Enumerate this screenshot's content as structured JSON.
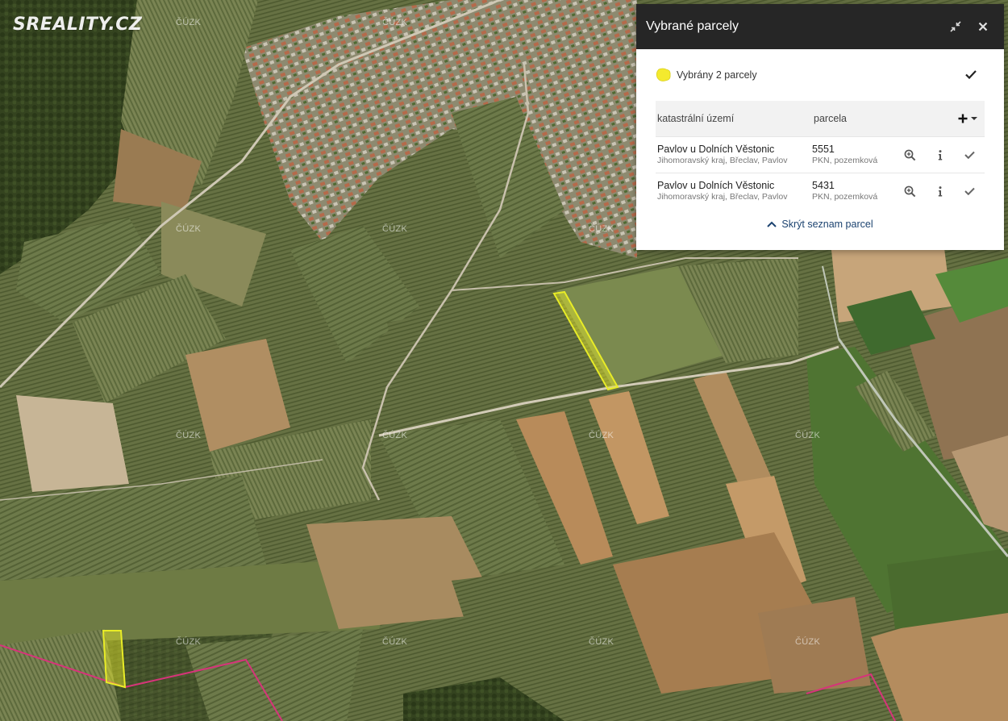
{
  "branding": {
    "logo_text": "SREALITY.CZ"
  },
  "map": {
    "watermark_text": "ČÚZK",
    "highlight_color": "#e8ec27",
    "boundary_color": "#d6347a"
  },
  "panel": {
    "title": "Vybrané parcely",
    "minimize_icon": "collapse-arrows-icon",
    "close_icon": "close-icon",
    "summary": {
      "text": "Vybrány 2 parcely",
      "shape_color": "#f4ea2e"
    },
    "table": {
      "headers": {
        "cadastral_area": "katastrální území",
        "parcel": "parcela"
      },
      "rows": [
        {
          "area_name": "Pavlov u Dolních Věstonic",
          "area_detail": "Jihomoravský kraj, Břeclav, Pavlov",
          "parcel_number": "5551",
          "parcel_type": "PKN, pozemková"
        },
        {
          "area_name": "Pavlov u Dolních Věstonic",
          "area_detail": "Jihomoravský kraj, Břeclav, Pavlov",
          "parcel_number": "5431",
          "parcel_type": "PKN, pozemková"
        }
      ]
    },
    "hide_list_label": "Skrýt seznam parcel",
    "accent_color": "#1c4370"
  }
}
